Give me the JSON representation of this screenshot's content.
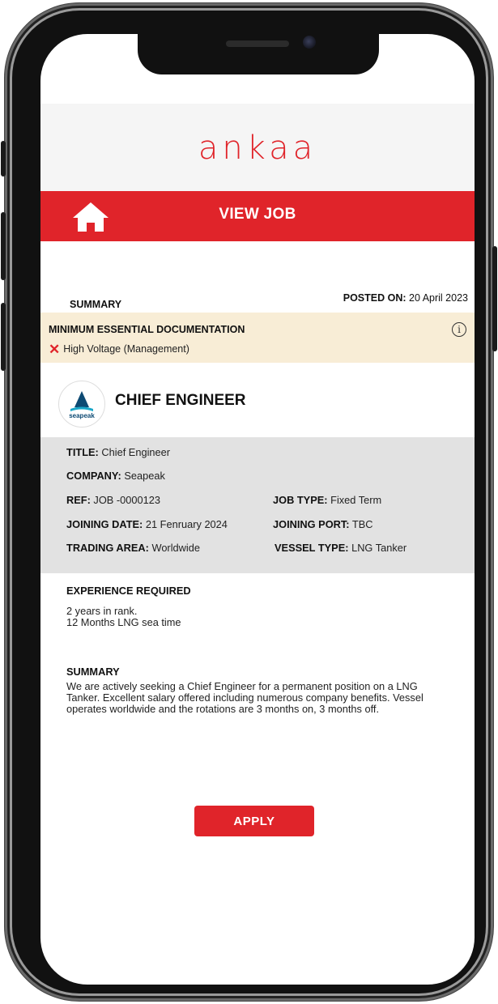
{
  "app": {
    "logo_text": "ankaa",
    "brand_color": "#e0242a"
  },
  "topbar": {
    "title": "VIEW JOB",
    "home_icon": "home-icon"
  },
  "summary": {
    "label": "SUMMARY",
    "posted_label": "POSTED ON:",
    "posted_value": "20 April 2023"
  },
  "documentation": {
    "title": "MINIMUM ESSENTIAL DOCUMENTATION",
    "info_icon": "info-icon",
    "items": [
      {
        "status_icon": "x-icon",
        "label": "High Voltage (Management)"
      }
    ]
  },
  "job": {
    "company_logo_text": "seapeak",
    "heading": "CHIEF ENGINEER",
    "title_label": "TITLE:",
    "title_value": "Chief Engineer",
    "company_label": "COMPANY:",
    "company_value": "Seapeak",
    "ref_label": "REF:",
    "ref_value": "JOB -0000123",
    "job_type_label": "JOB TYPE:",
    "job_type_value": "Fixed Term",
    "joining_date_label": "JOINING DATE:",
    "joining_date_value": "21 Fenruary 2024",
    "joining_port_label": "JOINING PORT:",
    "joining_port_value": "TBC",
    "trading_area_label": "TRADING AREA:",
    "trading_area_value": "Worldwide",
    "vessel_type_label": "VESSEL TYPE:",
    "vessel_type_value": "LNG Tanker"
  },
  "experience": {
    "title": "EXPERIENCE REQUIRED",
    "lines": [
      "2 years in rank.",
      "12 Months LNG sea time"
    ]
  },
  "summary2": {
    "title": "SUMMARY",
    "body": "We are actively seeking a Chief Engineer for a permanent position on a LNG Tanker. Excellent salary offered including numerous company benefits. Vessel operates worldwide and the rotations are 3 months on, 3 months off."
  },
  "actions": {
    "apply_label": "APPLY"
  }
}
